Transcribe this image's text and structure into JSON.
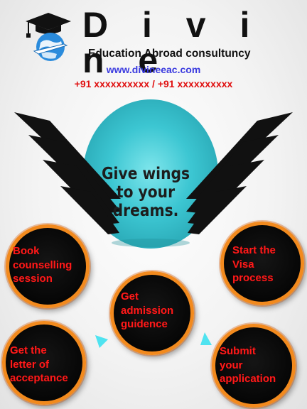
{
  "header": {
    "brand": "D i v i n e",
    "tagline": "Education Abroad consultuncy",
    "website": "www.divineeac.com",
    "phones": "+91 xxxxxxxxxx / +91 xxxxxxxxxx",
    "logo_icon": "graduation-cap-globe-plane-icon"
  },
  "hero": {
    "slogan_lines": [
      "Give wings",
      "to your",
      "dreams."
    ],
    "egg_color": "#3cc6d2",
    "wing_color": "#111111"
  },
  "steps": [
    {
      "lines": [
        "Book",
        "counselling",
        "session"
      ]
    },
    {
      "lines": [
        "Start the",
        "Visa",
        "process"
      ]
    },
    {
      "lines": [
        "Get",
        "admission",
        "guidence"
      ]
    },
    {
      "lines": [
        "Get the",
        "letter of",
        "acceptance"
      ]
    },
    {
      "lines": [
        "Submit",
        "your",
        "application"
      ]
    }
  ],
  "colors": {
    "circle_ring": "#f28a1e",
    "circle_text": "#ff1a1a",
    "arrow": "#4fe3f0",
    "website": "#3a3adf",
    "phones": "#e01010"
  }
}
